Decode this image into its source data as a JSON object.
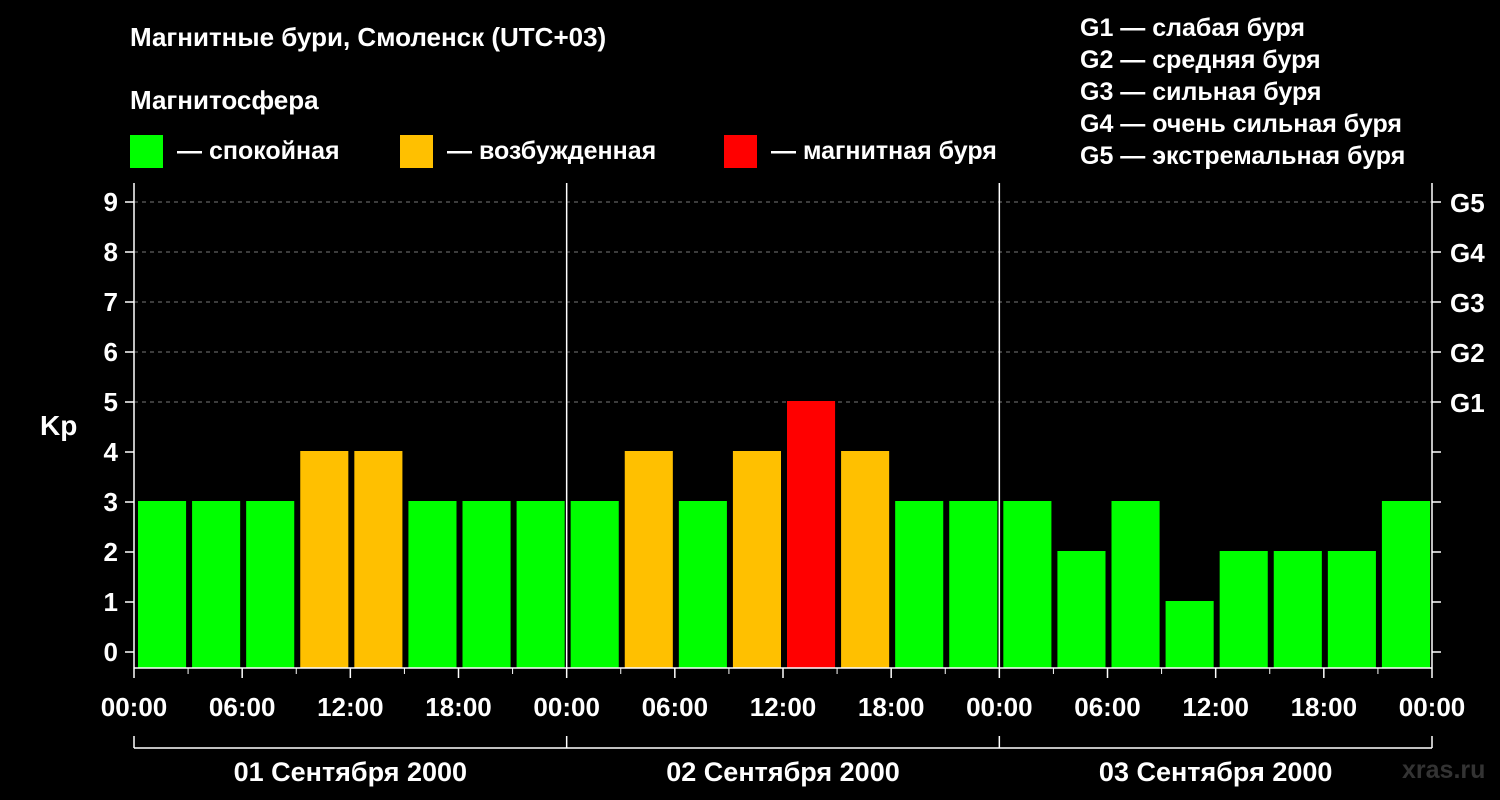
{
  "chart_data": {
    "type": "bar",
    "title": "Магнитные бури, Смоленск (UTC+03)",
    "subtitle": "Магнитосфера",
    "ylabel": "Kp",
    "ylim": [
      0,
      9
    ],
    "yticks": [
      "0",
      "1",
      "2",
      "3",
      "4",
      "5",
      "6",
      "7",
      "8",
      "9"
    ],
    "right_ticks": [
      {
        "value": 5,
        "label": "G1"
      },
      {
        "value": 6,
        "label": "G2"
      },
      {
        "value": 7,
        "label": "G3"
      },
      {
        "value": 8,
        "label": "G4"
      },
      {
        "value": 9,
        "label": "G5"
      }
    ],
    "xtick_labels": [
      "00:00",
      "06:00",
      "12:00",
      "18:00",
      "00:00",
      "06:00",
      "12:00",
      "18:00",
      "00:00",
      "06:00",
      "12:00",
      "18:00",
      "00:00"
    ],
    "days": [
      "01 Сентября 2000",
      "02 Сентября 2000",
      "03 Сентября 2000"
    ],
    "values": [
      3,
      3,
      3,
      4,
      4,
      3,
      3,
      3,
      3,
      4,
      3,
      4,
      5,
      4,
      3,
      3,
      3,
      2,
      3,
      1,
      2,
      2,
      2,
      3
    ],
    "grid": "dashed horizontal at Kp 5-9",
    "colors": {
      "calm": "#00ff00",
      "excited": "#ffc000",
      "storm": "#ff0000"
    },
    "legend": [
      {
        "label": "— спокойная",
        "color": "#00ff00"
      },
      {
        "label": "— возбужденная",
        "color": "#ffc000"
      },
      {
        "label": "— магнитная буря",
        "color": "#ff0000"
      }
    ],
    "g_legend": [
      "G1 — слабая буря",
      "G2 — средняя буря",
      "G3 — сильная буря",
      "G4 — очень сильная буря",
      "G5 — экстремальная буря"
    ]
  },
  "watermark": "xras.ru"
}
